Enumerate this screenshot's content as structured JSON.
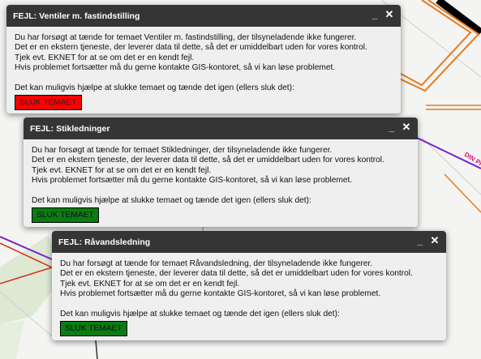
{
  "map": {
    "pipe_label": "DIN PI"
  },
  "dialogs": [
    {
      "title": "FEJL: Ventiler m. fastindstilling",
      "lines": [
        "Du har forsøgt at tænde for temaet Ventiler m. fastindstilling, der tilsyneladende ikke fungerer.",
        "Det er en ekstern tjeneste, der leverer data til dette, så det er umiddelbart uden for vores kontrol.",
        "Tjek evt. EKNET for at se om det er en kendt fejl.",
        "Hvis problemet fortsætter må du gerne kontakte GIS-kontoret, så vi kan løse problemet."
      ],
      "prompt": "Det kan muligvis hjælpe at slukke temaet og tænde det igen (ellers sluk det):",
      "button_label": "SLUK TEMAET",
      "button_color": "#ff0000"
    },
    {
      "title": "FEJL: Stikledninger",
      "lines": [
        "Du har forsøgt at tænde for temaet Stikledninger, der tilsyneladende ikke fungerer.",
        "Det er en ekstern tjeneste, der leverer data til dette, så det er umiddelbart uden for vores kontrol.",
        "Tjek evt. EKNET for at se om det er en kendt fejl.",
        "Hvis problemet fortsætter må du gerne kontakte GIS-kontoret, så vi kan løse problemet."
      ],
      "prompt": "Det kan muligvis hjælpe at slukke temaet og tænde det igen (ellers sluk det):",
      "button_label": "SLUK TEMAET",
      "button_color": "#0a7d12"
    },
    {
      "title": "FEJL: Råvandsledning",
      "lines": [
        "Du har forsøgt at tænde for temaet Råvandsledning, der tilsyneladende ikke fungerer.",
        "Det er en ekstern tjeneste, der leverer data til dette, så det er umiddelbart uden for vores kontrol.",
        "Tjek evt. EKNET for at se om det er en kendt fejl.",
        "Hvis problemet fortsætter må du gerne kontakte GIS-kontoret, så vi kan løse problemet."
      ],
      "prompt": "Det kan muligvis hjælpe at slukke temaet og tænde det igen (ellers sluk det):",
      "button_label": "SLUK TEMAET",
      "button_color": "#0a7d12"
    }
  ],
  "controls": {
    "minimize_glyph": "_",
    "close_glyph": "✕"
  }
}
